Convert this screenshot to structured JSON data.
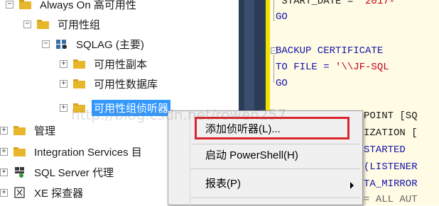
{
  "tree": {
    "items": [
      {
        "label": "Always On 高可用性",
        "expander": "⊟"
      },
      {
        "label": "可用性组",
        "expander": "⊟"
      },
      {
        "label": "SQLAG (主要)",
        "expander": "⊟"
      },
      {
        "label": "可用性副本",
        "expander": "⊞"
      },
      {
        "label": "可用性数据库",
        "expander": "⊞"
      },
      {
        "label": "可用性组侦听器",
        "expander": "⊞",
        "selected": true
      },
      {
        "label": "管理",
        "expander": "⊞"
      },
      {
        "label": "Integration Services 目",
        "expander": "⊞"
      },
      {
        "label": "SQL Server 代理",
        "expander": "⊞"
      },
      {
        "label": "XE 探查器",
        "expander": "⊞"
      }
    ]
  },
  "editor": {
    "lines": [
      {
        "parts": [
          {
            "t": " START_DATE = ",
            "c": ""
          },
          {
            "t": "'2017-",
            "c": "str"
          }
        ]
      },
      {
        "parts": [
          {
            "t": "GO",
            "c": "kw"
          }
        ]
      },
      {
        "parts": [
          {
            "t": "BACKUP CERTIFICATE ",
            "c": "kw"
          }
        ]
      },
      {
        "parts": [
          {
            "t": "TO FILE = ",
            "c": "kw"
          },
          {
            "t": "'\\\\JF-SQL",
            "c": "str"
          }
        ]
      },
      {
        "parts": [
          {
            "t": "GO",
            "c": "kw"
          }
        ]
      },
      {
        "parts": [
          {
            "t": "POINT [SQ",
            "c": ""
          }
        ]
      },
      {
        "parts": [
          {
            "t": "IZATION [",
            "c": ""
          }
        ]
      },
      {
        "parts": [
          {
            "t": "STARTED",
            "c": "kw"
          }
        ]
      },
      {
        "parts": [
          {
            "t": "(LISTENER",
            "c": ""
          }
        ]
      },
      {
        "parts": [
          {
            "t": "TA_MIRROR",
            "c": "kw"
          }
        ]
      },
      {
        "parts": [
          {
            "t": "= ALL AUT",
            "c": ""
          }
        ]
      }
    ]
  },
  "context_menu": {
    "items": [
      "添加侦听器(L)...",
      "启动 PowerShell(H)",
      "报表(P)"
    ]
  },
  "watermark": "http://blog.csdn.net/rowen257",
  "colors": {
    "selection": "#3399ff",
    "highlight_box": "#d9252b",
    "divider": "#2b3c57"
  }
}
